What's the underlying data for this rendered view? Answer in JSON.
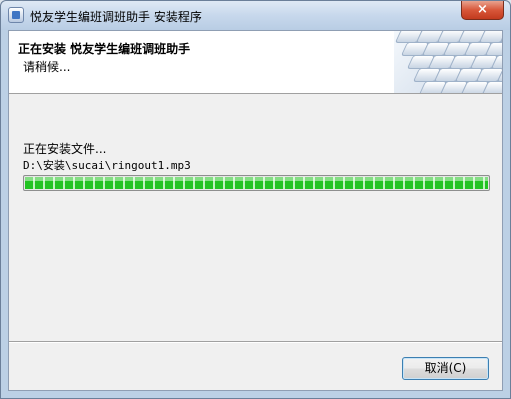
{
  "window": {
    "title": "悦友学生编班调班助手 安装程序",
    "close_glyph": "×"
  },
  "header": {
    "title": "正在安装 悦友学生编班调班助手",
    "subtitle": "请稍候..."
  },
  "install": {
    "status_label": "正在安装文件...",
    "current_file": "D:\\安装\\sucai\\ringout1.mp3",
    "progress_fraction": 1.0
  },
  "buttons": {
    "cancel_label": "取消(C)"
  },
  "icons": {
    "app": "installer-app-icon",
    "close": "close-icon",
    "header_image": "keyboard-image"
  },
  "colors": {
    "progress_fill": "#22c322",
    "close_button": "#d8573a"
  }
}
